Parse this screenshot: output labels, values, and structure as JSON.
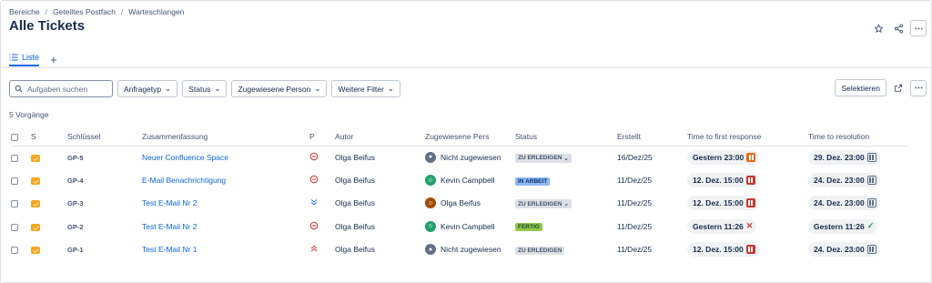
{
  "breadcrumb": [
    "Bereiche",
    "Geteiltes Postfach",
    "Warteschlangen"
  ],
  "title": "Alle Tickets",
  "tabs": {
    "liste": "Liste"
  },
  "search": {
    "placeholder": "Aufgaben suchen"
  },
  "filters": [
    "Anfragetyp",
    "Status",
    "Zugewiesene Person",
    "Weitere Filter"
  ],
  "actions": {
    "select": "Selektieren"
  },
  "count": "5 Vorgänge",
  "columns": {
    "s": "S",
    "key": "Schlüssel",
    "summary": "Zusammenfassung",
    "p": "P",
    "author": "Autor",
    "assignee": "Zugewiesene Pers",
    "status": "Status",
    "created": "Erstellt",
    "ttfr": "Time to first response",
    "ttr": "Time to resolution"
  },
  "rows": [
    {
      "key": "GP-5",
      "summary": "Neuer Confluence Space",
      "priority": "medium",
      "author": "Olga Beifus",
      "assignee": "Nicht zugewiesen",
      "avatar": "none",
      "status": "ZU ERLEDIGEN",
      "status_type": "todo",
      "status_chevron": true,
      "created": "16/Dez/25",
      "ttfr": "Gestern 23:00",
      "ttfr_icon": "pause-orange",
      "ttr": "29. Dez. 23:00",
      "ttr_icon": "pause-grey"
    },
    {
      "key": "GP-4",
      "summary": "E-Mail Benachrichtigung",
      "priority": "medium",
      "author": "Olga Beifus",
      "assignee": "Kevin Campbell",
      "avatar": "kevin",
      "status": "IN ARBEIT",
      "status_type": "prog",
      "status_chevron": false,
      "created": "11/Dez/25",
      "ttfr": "12. Dez. 15:00",
      "ttfr_icon": "pause-red",
      "ttr": "24. Dez. 23:00",
      "ttr_icon": "pause-grey"
    },
    {
      "key": "GP-3",
      "summary": "Test E-Mail Nr 2",
      "priority": "lowest",
      "author": "Olga Beifus",
      "assignee": "Olga Beifus",
      "avatar": "olga",
      "status": "ZU ERLEDIGEN",
      "status_type": "todo",
      "status_chevron": true,
      "created": "11/Dez/25",
      "ttfr": "12. Dez. 15:00",
      "ttfr_icon": "pause-red",
      "ttr": "24. Dez. 23:00",
      "ttr_icon": "pause-grey"
    },
    {
      "key": "GP-2",
      "summary": "Test E-Mail Nr 2",
      "priority": "medium",
      "author": "Olga Beifus",
      "assignee": "Kevin Campbell",
      "avatar": "kevin",
      "status": "FERTIG",
      "status_type": "done",
      "status_chevron": false,
      "created": "11/Dez/25",
      "ttfr": "Gestern 11:26",
      "ttfr_icon": "x",
      "ttr": "Gestern 11:26",
      "ttr_icon": "check"
    },
    {
      "key": "GP-1",
      "summary": "Test E-Mail Nr 1",
      "priority": "highest",
      "author": "Olga Beifus",
      "assignee": "Nicht zugewiesen",
      "avatar": "none",
      "status": "ZU ERLEDIGEN",
      "status_type": "todo",
      "status_chevron": false,
      "created": "11/Dez/25",
      "ttfr": "12. Dez. 15:00",
      "ttfr_icon": "pause-red",
      "ttr": "24. Dez. 23:00",
      "ttr_icon": "pause-grey"
    }
  ]
}
